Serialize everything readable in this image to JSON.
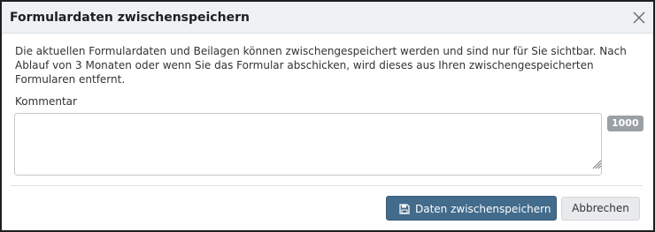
{
  "dialog": {
    "title": "Formulardaten zwischenspeichern",
    "close_icon": "close-icon",
    "body_text": "Die aktuellen Formulardaten und Beilagen können zwischengespeichert werden und sind nur für Sie sichtbar. Nach Ablauf von 3 Monaten oder wenn Sie das Formular abschicken, wird dieses aus Ihren zwischengespeicherten Formularen entfernt.",
    "comment": {
      "label": "Kommentar",
      "value": "",
      "char_counter": "1000"
    },
    "buttons": {
      "save_icon": "floppy-disk-icon",
      "save_label": "Daten zwischenspeichern",
      "cancel_label": "Abbrechen"
    },
    "colors": {
      "primary_button": "#426b8c",
      "title_bar": "#eef2f5",
      "counter_badge": "#9aa0a5"
    }
  }
}
